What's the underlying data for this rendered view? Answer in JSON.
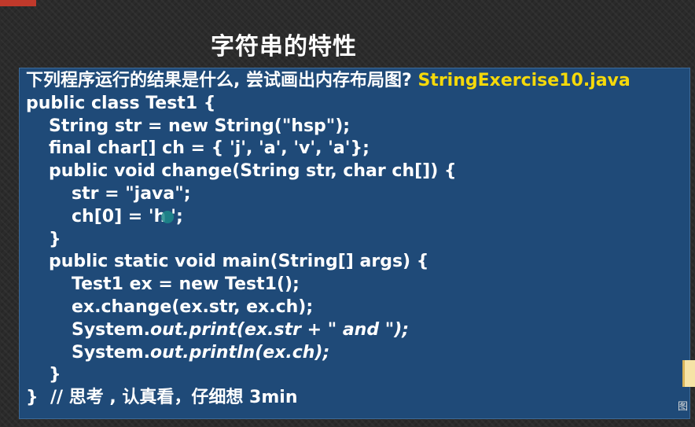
{
  "slide": {
    "title": "字符串的特性"
  },
  "code": {
    "question": "下列程序运行的结果是什么, 尝试画出内存布局图? ",
    "file_name": "StringExercise10.java",
    "line_class": "public class Test1 {",
    "line_field_str": "String str = new String(\"hsp\");",
    "line_field_ch": "final char[] ch = { 'j', 'a', 'v', 'a'};",
    "line_change_sig": "public void change(String str, char ch[]) {",
    "line_assign_str": "str = \"java\";",
    "line_assign_ch_a": "ch[0] = 'h",
    "line_assign_ch_b": "';",
    "line_close_method": "}",
    "line_main_sig": "public static void main(String[] args) {",
    "line_new_obj": "Test1 ex = new Test1();",
    "line_call_change": "ex.change(ex.str, ex.ch);",
    "print_prefix": "System.",
    "print_call": "out.print(ex.str + \" and \");",
    "println_prefix": "System.",
    "println_call": "out.println(ex.ch);",
    "line_close_main": "}",
    "line_close_class": "}  // 思考 , 认真看，仔细想 3min"
  },
  "desktop": {
    "folder_label": "图"
  },
  "colors": {
    "panel_bg": "#1f4a78",
    "highlight": "#f5d90a",
    "text": "#ffffff"
  }
}
